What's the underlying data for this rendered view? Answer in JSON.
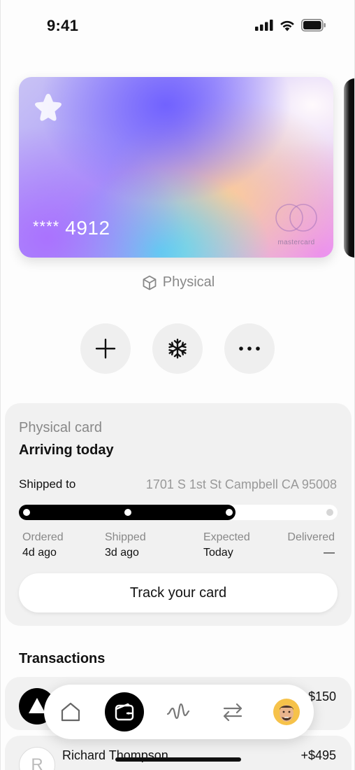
{
  "status_bar": {
    "time": "9:41"
  },
  "card": {
    "mask": "****",
    "last4": "4912",
    "network_label": "mastercard",
    "type_label": "Physical"
  },
  "actions": [
    {
      "name": "add-icon"
    },
    {
      "name": "freeze-icon"
    },
    {
      "name": "more-icon"
    }
  ],
  "physical_card": {
    "subtitle": "Physical card",
    "title": "Arriving today",
    "shipped_to_label": "Shipped to",
    "address": "1701 S 1st St Campbell CA 95008",
    "progress_fraction": 0.68,
    "steps": [
      {
        "name": "Ordered",
        "value": "4d ago"
      },
      {
        "name": "Shipped",
        "value": "3d ago"
      },
      {
        "name": "Expected",
        "value": "Today"
      },
      {
        "name": "Delivered",
        "value": "—"
      }
    ],
    "track_button": "Track your card"
  },
  "transactions": {
    "title": "Transactions",
    "items": [
      {
        "name": "",
        "amount": "$150",
        "avatar": "black"
      },
      {
        "name": "Richard Thompson",
        "amount": "+$495",
        "avatar_letter": "R"
      }
    ]
  },
  "nav": {
    "items": [
      {
        "name": "home-icon"
      },
      {
        "name": "wallet-icon",
        "active": true
      },
      {
        "name": "activity-icon"
      },
      {
        "name": "transfer-icon"
      },
      {
        "name": "profile-avatar"
      }
    ]
  },
  "colors": {
    "accent": "#000000",
    "panel_bg": "#f1f1f1"
  }
}
